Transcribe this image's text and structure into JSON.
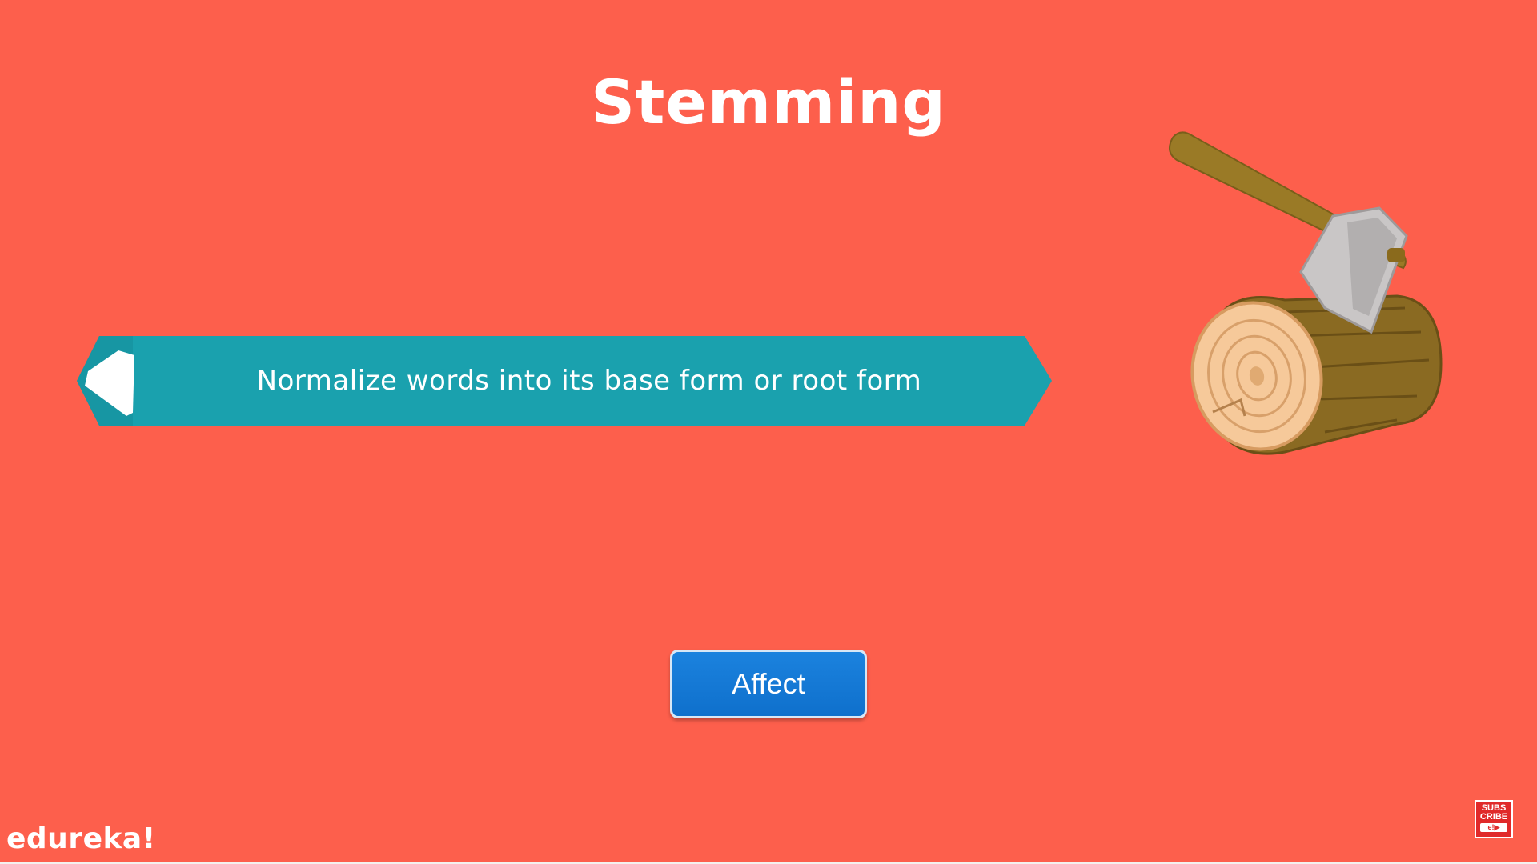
{
  "slide": {
    "title": "Stemming",
    "banner_text": "Normalize words into its base form or root form",
    "button_label": "Affect",
    "illustration_icon": "axe-in-log-icon"
  },
  "branding": {
    "logo_text": "edureka!",
    "subscribe_line1": "SUBS",
    "subscribe_line2": "CRIBE",
    "subscribe_mark": "e!▶"
  },
  "colors": {
    "background": "#fd5f4c",
    "banner": "#1aa1ae",
    "button": "#1378d6",
    "text": "#ffffff"
  }
}
